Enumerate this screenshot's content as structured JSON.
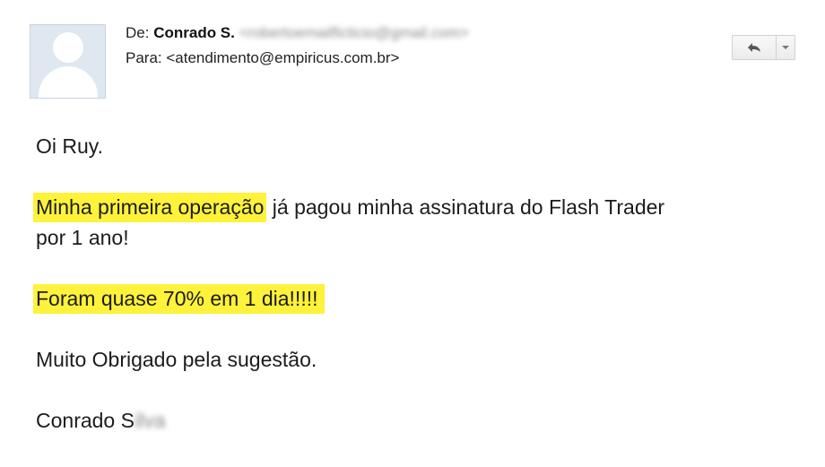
{
  "header": {
    "from_label": "De:",
    "from_name": "Conrado S.",
    "from_email": "<robertoemailficticio@gmail.com>",
    "to_label": "Para:",
    "to_email": "<atendimento@empiricus.com.br>"
  },
  "toolbar": {
    "reply_icon": "reply-arrow-icon",
    "more_icon": "chevron-down-icon"
  },
  "message": {
    "greeting": "Oi Ruy.",
    "p1_highlight": "Minha primeira operação",
    "p1_rest": " já pagou minha assinatura do Flash Trader",
    "p1_line2": "por 1 ano!",
    "p2_highlight": "Foram quase 70% em 1 dia!!!!!",
    "p3": "Muito Obrigado pela sugestão.",
    "signature_visible": "Conrado S",
    "signature_blurred": "ilva"
  },
  "colors": {
    "highlight": "#fff23a",
    "avatar_bg": "#dfe7f1"
  }
}
